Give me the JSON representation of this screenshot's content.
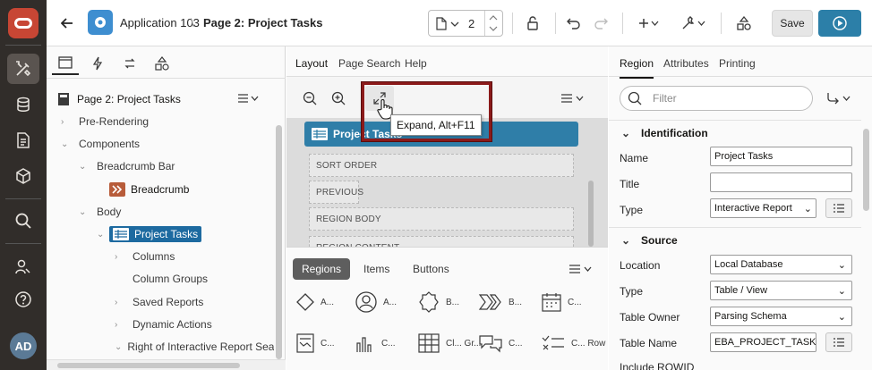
{
  "rail": {
    "items": [
      "app-builder",
      "sql-workshop",
      "team-development",
      "gallery",
      "search",
      "administration",
      "help"
    ],
    "avatar": "AD"
  },
  "topbar": {
    "application": "Application 103",
    "page_title": "Page 2: Project Tasks",
    "page_number": "2",
    "save_label": "Save"
  },
  "left": {
    "header": "Page 2: Project Tasks",
    "tree": [
      "Pre-Rendering",
      "Components",
      "Breadcrumb Bar",
      "Breadcrumb",
      "Body",
      "Project Tasks",
      "Columns",
      "Column Groups",
      "Saved Reports",
      "Dynamic Actions",
      "Right of Interactive Report Searc"
    ]
  },
  "middle": {
    "tabs": [
      "Layout",
      "Page Search",
      "Help"
    ],
    "region_title": "Project Tasks",
    "slots": [
      "SORT ORDER",
      "PREVIOUS",
      "REGION BODY",
      "REGION CONTENT"
    ],
    "tooltip": "Expand, Alt+F11",
    "gallery_tabs": [
      "Regions",
      "Items",
      "Buttons"
    ],
    "gallery": [
      {
        "label": "A...",
        "icon": "diamond-icon"
      },
      {
        "label": "A...",
        "icon": "avatar-icon"
      },
      {
        "label": "B...",
        "icon": "badge-icon"
      },
      {
        "label": "B...",
        "icon": "breadcrumb-icon"
      },
      {
        "label": "C...",
        "icon": "calendar-icon"
      },
      {
        "label": "C...",
        "icon": "card-icon"
      },
      {
        "label": "C...",
        "icon": "chart-icon"
      },
      {
        "label": "Cl... Gr...",
        "icon": "classic-grid-icon"
      },
      {
        "label": "C...",
        "icon": "comments-icon"
      },
      {
        "label": "C... Row",
        "icon": "content-row-icon"
      }
    ]
  },
  "right": {
    "tabs": [
      "Region",
      "Attributes",
      "Printing"
    ],
    "filter_placeholder": "Filter",
    "identification": {
      "heading": "Identification",
      "name_label": "Name",
      "name_value": "Project Tasks",
      "title_label": "Title",
      "title_value": "",
      "type_label": "Type",
      "type_value": "Interactive Report"
    },
    "source": {
      "heading": "Source",
      "location_label": "Location",
      "location_value": "Local Database",
      "type_label": "Type",
      "type_value": "Table / View",
      "owner_label": "Table Owner",
      "owner_value": "Parsing Schema",
      "table_label": "Table Name",
      "table_value": "EBA_PROJECT_TASKS",
      "rowid_label": "Include ROWID"
    }
  },
  "colors": {
    "rail": "#312d2a",
    "accent": "#2f7ea8",
    "logo": "#c74634",
    "highlight": "#8b1a1a"
  }
}
